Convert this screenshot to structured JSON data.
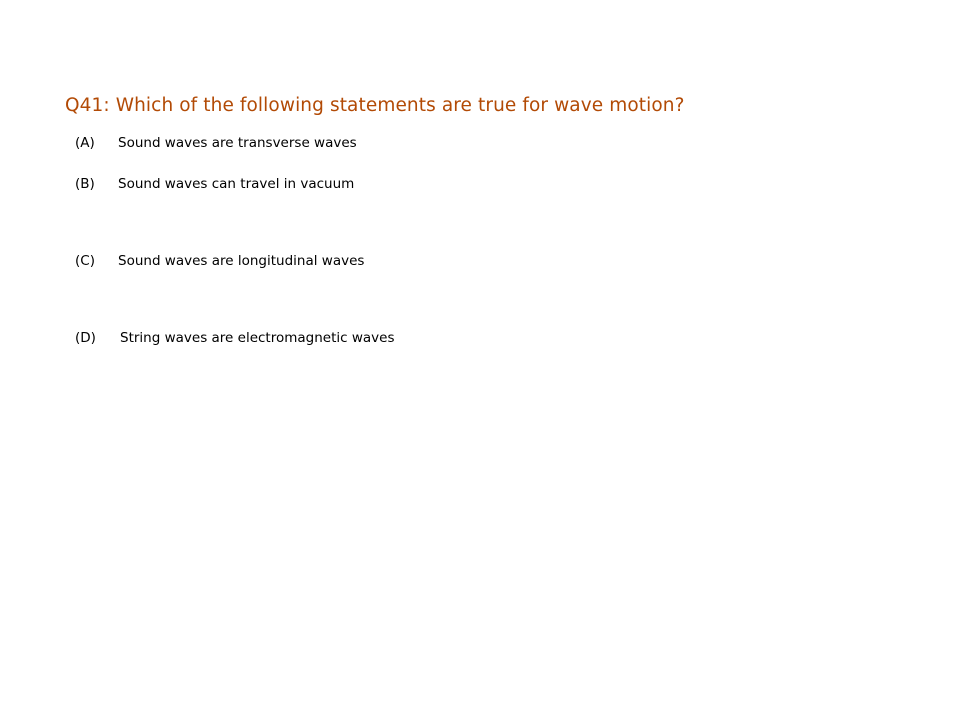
{
  "question": {
    "text": "Q41: Which of the following statements are true for wave motion?"
  },
  "options": [
    {
      "letter": "(A)",
      "text": "Sound waves are transverse waves"
    },
    {
      "letter": "(B)",
      "text": "Sound waves can travel in  vacuum"
    },
    {
      "letter": "(C)",
      "text": "Sound waves are longitudinal waves"
    },
    {
      "letter": "(D)",
      "text": "String waves are electromagnetic waves"
    }
  ],
  "colors": {
    "question": "#b24a05",
    "option_text": "#000000",
    "background": "#ffffff"
  }
}
